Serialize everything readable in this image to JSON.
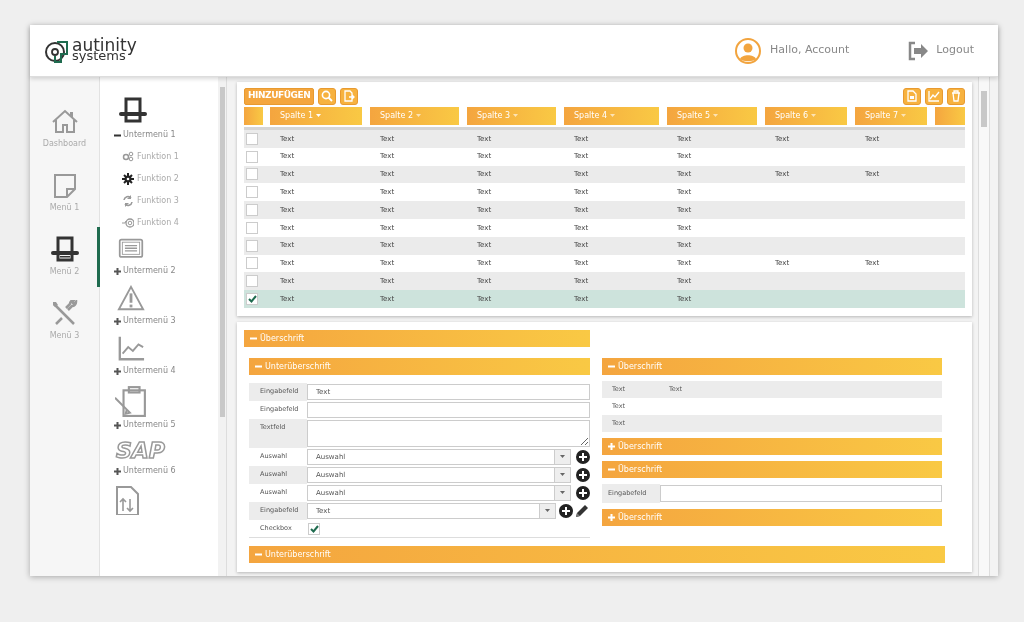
{
  "header": {
    "logo": {
      "line1": "autinity",
      "line2": "systems"
    },
    "account": "Hallo, Account",
    "logout": "Logout"
  },
  "nav": [
    {
      "label": "Dashboard",
      "selected": false
    },
    {
      "label": "Menü 1",
      "selected": false
    },
    {
      "label": "Menü 2",
      "selected": true
    },
    {
      "label": "Menü 3",
      "selected": false
    }
  ],
  "submenu": [
    {
      "label": "Untermenü 1",
      "expanded": true,
      "children": [
        {
          "label": "Funktion 1",
          "selected": false
        },
        {
          "label": "Funktion 2",
          "selected": true
        },
        {
          "label": "Funktion 3",
          "selected": false
        },
        {
          "label": "Funktion 4",
          "selected": false
        }
      ]
    },
    {
      "label": "Untermenü 2",
      "expanded": false
    },
    {
      "label": "Untermenü 3",
      "expanded": false
    },
    {
      "label": "Untermenü 4",
      "expanded": false
    },
    {
      "label": "Untermenü 5",
      "expanded": false
    },
    {
      "label": "Untermenü 6",
      "expanded": false,
      "logo_text": "SAP"
    }
  ],
  "table": {
    "add_button": "HINZUFÜGEN",
    "columns": [
      "Spalte 1",
      "Spalte 2",
      "Spalte 3",
      "Spalte 4",
      "Spalte 5",
      "Spalte 6",
      "Spalte 7"
    ],
    "rows": [
      {
        "selected": false,
        "cells": [
          "Text",
          "Text",
          "Text",
          "Text",
          "Text",
          "Text",
          "Text"
        ]
      },
      {
        "selected": false,
        "cells": [
          "Text",
          "Text",
          "Text",
          "Text",
          "Text"
        ]
      },
      {
        "selected": false,
        "cells": [
          "Text",
          "Text",
          "Text",
          "Text",
          "Text",
          "Text",
          "Text"
        ]
      },
      {
        "selected": false,
        "cells": [
          "Text",
          "Text",
          "Text",
          "Text",
          "Text"
        ]
      },
      {
        "selected": false,
        "cells": [
          "Text",
          "Text",
          "Text",
          "Text",
          "Text"
        ]
      },
      {
        "selected": false,
        "cells": [
          "Text",
          "Text",
          "Text",
          "Text",
          "Text"
        ]
      },
      {
        "selected": false,
        "cells": [
          "Text",
          "Text",
          "Text",
          "Text",
          "Text"
        ]
      },
      {
        "selected": false,
        "cells": [
          "Text",
          "Text",
          "Text",
          "Text",
          "Text",
          "Text",
          "Text"
        ]
      },
      {
        "selected": false,
        "cells": [
          "Text",
          "Text",
          "Text",
          "Text",
          "Text"
        ]
      },
      {
        "selected": true,
        "cells": [
          "Text",
          "Text",
          "Text",
          "Text",
          "Text"
        ]
      }
    ]
  },
  "form": {
    "title": "Überschrift",
    "expanded": true,
    "subsections": [
      {
        "title": "Unterüberschrift",
        "expanded": true,
        "fields": [
          {
            "kind": "text",
            "label": "Eingabefeld",
            "value": "Text"
          },
          {
            "kind": "text",
            "label": "Eingabefeld"
          },
          {
            "kind": "textarea",
            "label": "Textfeld"
          },
          {
            "kind": "select",
            "label": "Auswahl",
            "value": "Auswahl"
          },
          {
            "kind": "select",
            "label": "Auswahl",
            "value": "Auswahl"
          },
          {
            "kind": "select",
            "label": "Auswahl",
            "value": "Auswahl"
          },
          {
            "kind": "combo",
            "label": "Eingabefeld",
            "value": "Text"
          },
          {
            "kind": "checkbox",
            "label": "Checkbox",
            "checked": true
          }
        ]
      },
      {
        "title": "Unterüberschrift",
        "expanded": true
      }
    ],
    "side_panels": [
      {
        "title": "Überschrift",
        "expanded": true,
        "kind": "list",
        "rows": [
          [
            "Text",
            "Text"
          ],
          [
            "Text"
          ],
          [
            "Text"
          ]
        ]
      },
      {
        "title": "Überschrift",
        "expanded": false
      },
      {
        "title": "Überschrift",
        "expanded": true,
        "kind": "input",
        "label": "Eingabefeld"
      },
      {
        "title": "Überschrift",
        "expanded": false
      }
    ]
  }
}
